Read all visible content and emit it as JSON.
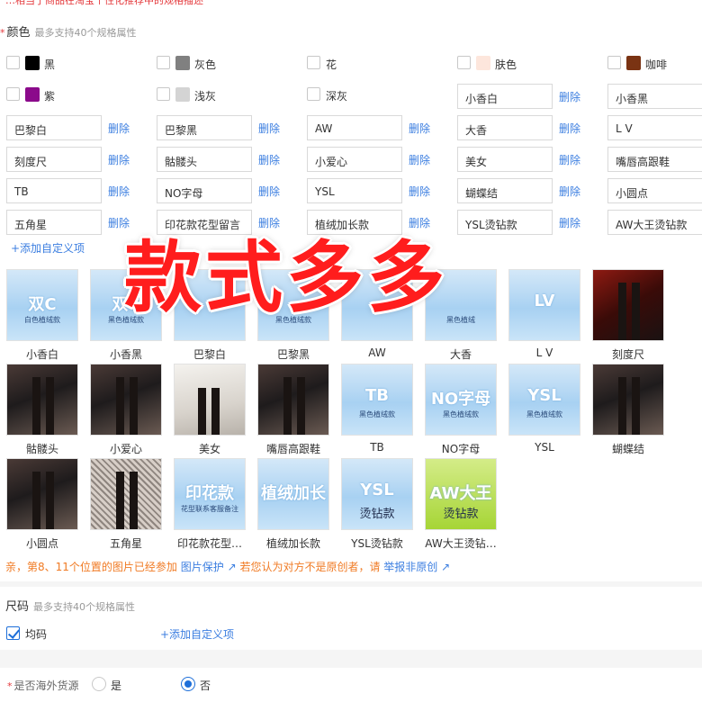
{
  "topbar": {
    "text": "…相当于商品在淘宝个性化推荐中的规格描述"
  },
  "color_section": {
    "title": "颜色",
    "hint": "最多支持40个规格属性",
    "preset_colors": [
      {
        "label": "黑",
        "swatch": "#000000"
      },
      {
        "label": "灰色",
        "swatch": "#808080"
      },
      {
        "label": "花",
        "swatch": ""
      },
      {
        "label": "肤色",
        "swatch": "#fde6dc"
      },
      {
        "label": "咖啡",
        "swatch": "#7a3313"
      },
      {
        "label": "紫",
        "swatch": "#8b0a8b"
      },
      {
        "label": "浅灰",
        "swatch": "#d4d4d4"
      },
      {
        "label": "深灰",
        "swatch": ""
      }
    ],
    "delete_label": "删除",
    "custom_values": [
      "小香白",
      "小香黑",
      "巴黎白",
      "巴黎黑",
      "AW",
      "大香",
      "L V",
      "刻度尺",
      "骷髅头",
      "小爱心",
      "美女",
      "嘴唇高跟鞋",
      "TB",
      "NO字母",
      "YSL",
      "蝴蝶结",
      "小圆点",
      "五角星",
      "印花款花型留言",
      "植绒加长款",
      "YSL烫钻款",
      "AW大王烫钻款"
    ],
    "add_custom": "+添加自定义项",
    "thumbs": [
      {
        "caption": "小香白",
        "style": "blue",
        "big": "双C",
        "sub": "白色植绒款"
      },
      {
        "caption": "小香黑",
        "style": "blue",
        "big": "双C",
        "sub": "黑色植绒款"
      },
      {
        "caption": "巴黎白",
        "style": "blue",
        "big": "",
        "sub": ""
      },
      {
        "caption": "巴黎黑",
        "style": "blue",
        "big": "",
        "sub": "黑色植绒款"
      },
      {
        "caption": "AW",
        "style": "blue",
        "big": "",
        "sub": ""
      },
      {
        "caption": "大香",
        "style": "blue",
        "big": "",
        "sub": "黑色植绒"
      },
      {
        "caption": "L V",
        "style": "blue",
        "big": "LV",
        "sub": ""
      },
      {
        "caption": "刻度尺",
        "style": "photo-red",
        "big": "",
        "sub": ""
      },
      {
        "caption": "骷髅头",
        "style": "photo-dark",
        "big": "",
        "sub": ""
      },
      {
        "caption": "小爱心",
        "style": "photo-dark",
        "big": "",
        "sub": ""
      },
      {
        "caption": "美女",
        "style": "photo-light",
        "big": "",
        "sub": ""
      },
      {
        "caption": "嘴唇高跟鞋",
        "style": "photo-dark",
        "big": "",
        "sub": ""
      },
      {
        "caption": "TB",
        "style": "blue",
        "big": "TB",
        "sub": "黑色植绒款"
      },
      {
        "caption": "NO字母",
        "style": "blue",
        "big": "NO字母",
        "sub": "黑色植绒款"
      },
      {
        "caption": "YSL",
        "style": "blue",
        "big": "YSL",
        "sub": "黑色植绒款"
      },
      {
        "caption": "蝴蝶结",
        "style": "photo-dark",
        "big": "",
        "sub": ""
      },
      {
        "caption": "小圆点",
        "style": "photo-dark",
        "big": "",
        "sub": ""
      },
      {
        "caption": "五角星",
        "style": "photo-net",
        "big": "",
        "sub": ""
      },
      {
        "caption": "印花款花型…",
        "style": "blue",
        "big": "印花款",
        "sub": "花型联系客服备注"
      },
      {
        "caption": "植绒加长款",
        "style": "blue",
        "big": "植绒加长",
        "sub": ""
      },
      {
        "caption": "YSL烫钻款",
        "style": "blue",
        "big": "YSL",
        "sub": "烫钻款"
      },
      {
        "caption": "AW大王烫钻…",
        "style": "green",
        "big": "AW大王",
        "sub": "烫钻款"
      }
    ],
    "warning": {
      "text1": "亲，第8、11个位置的图片已经参加",
      "link1": "图片保护",
      "text2": "若您认为对方不是原创者，请",
      "link2": "举报非原创"
    }
  },
  "size_section": {
    "title": "尺码",
    "hint": "最多支持40个规格属性",
    "option": "均码",
    "add_custom": "+添加自定义项"
  },
  "overseas": {
    "label": "是否海外货源",
    "options": [
      "是",
      "否"
    ],
    "selected": "否"
  },
  "overlay_text": "款式多多"
}
